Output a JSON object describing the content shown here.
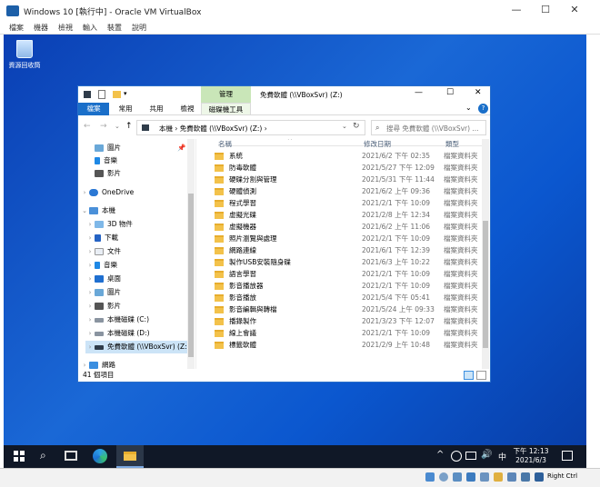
{
  "vbox": {
    "title": "Windows 10 [執行中] - Oracle VM VirtualBox",
    "menu": [
      "檔案",
      "機器",
      "檢視",
      "輸入",
      "裝置",
      "說明"
    ],
    "right_ctrl": "Right Ctrl"
  },
  "desktop": {
    "recycle_bin": "資源回收筒"
  },
  "explorer": {
    "context_group": "管理",
    "drive_title": "免費軟體 (\\\\VBoxSvr) (Z:)",
    "tabs": [
      "檔案",
      "常用",
      "共用",
      "檢視",
      "磁碟機工具"
    ],
    "address": "本機 › 免費軟體 (\\\\VBoxSvr) (Z:) ›",
    "search_placeholder": "搜尋 免費軟體 (\\\\VBoxSvr) ...",
    "columns": {
      "name": "名稱",
      "date": "修改日期",
      "type": "類型"
    },
    "nav": [
      {
        "label": "圖片"
      },
      {
        "label": "音樂"
      },
      {
        "label": "影片"
      },
      {
        "label": "OneDrive"
      },
      {
        "label": "本機"
      },
      {
        "label": "3D 物件"
      },
      {
        "label": "下載"
      },
      {
        "label": "文件"
      },
      {
        "label": "音樂"
      },
      {
        "label": "桌面"
      },
      {
        "label": "圖片"
      },
      {
        "label": "影片"
      },
      {
        "label": "本機磁碟 (C:)"
      },
      {
        "label": "本機磁碟 (D:)"
      },
      {
        "label": "免費軟體 (\\\\VBoxSvr) (Z:)"
      },
      {
        "label": "網路"
      }
    ],
    "files": [
      {
        "name": "系統",
        "date": "2021/6/2 下午 02:35",
        "type": "檔案資料夾"
      },
      {
        "name": "防毒軟體",
        "date": "2021/5/27 下午 12:09",
        "type": "檔案資料夾"
      },
      {
        "name": "硬碟分割與管理",
        "date": "2021/5/31 下午 11:44",
        "type": "檔案資料夾"
      },
      {
        "name": "硬體偵測",
        "date": "2021/6/2 上午 09:36",
        "type": "檔案資料夾"
      },
      {
        "name": "程式學習",
        "date": "2021/2/1 下午 10:09",
        "type": "檔案資料夾"
      },
      {
        "name": "虛擬光碟",
        "date": "2021/2/8 上午 12:34",
        "type": "檔案資料夾"
      },
      {
        "name": "虛擬機器",
        "date": "2021/6/2 上午 11:06",
        "type": "檔案資料夾"
      },
      {
        "name": "照片瀏覽與處理",
        "date": "2021/2/1 下午 10:09",
        "type": "檔案資料夾"
      },
      {
        "name": "網路連線",
        "date": "2021/6/1 下午 12:39",
        "type": "檔案資料夾"
      },
      {
        "name": "製作USB安裝隨身碟",
        "date": "2021/6/3 上午 10:22",
        "type": "檔案資料夾"
      },
      {
        "name": "語言學習",
        "date": "2021/2/1 下午 10:09",
        "type": "檔案資料夾"
      },
      {
        "name": "影音播放器",
        "date": "2021/2/1 下午 10:09",
        "type": "檔案資料夾"
      },
      {
        "name": "影音播放",
        "date": "2021/5/4 下午 05:41",
        "type": "檔案資料夾"
      },
      {
        "name": "影音編輯與轉檔",
        "date": "2021/5/24 上午 09:33",
        "type": "檔案資料夾"
      },
      {
        "name": "播錄製作",
        "date": "2021/3/23 下午 12:07",
        "type": "檔案資料夾"
      },
      {
        "name": "線上會議",
        "date": "2021/2/1 下午 10:09",
        "type": "檔案資料夾"
      },
      {
        "name": "標籤軟體",
        "date": "2021/2/9 上午 10:48",
        "type": "檔案資料夾"
      }
    ],
    "status": "41 個項目"
  },
  "taskbar": {
    "time": "下午 12:13",
    "date": "2021/6/3",
    "ime": "中"
  }
}
